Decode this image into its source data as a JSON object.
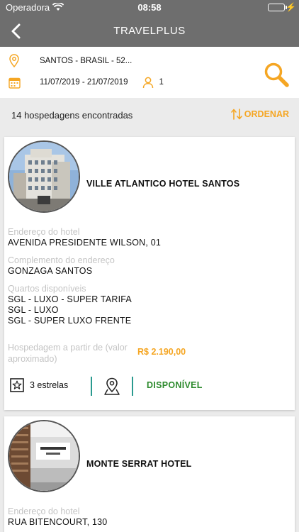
{
  "status_bar": {
    "carrier": "Operadora",
    "time": "08:58"
  },
  "navbar": {
    "title": "TRAVELPLUS"
  },
  "search": {
    "location": "SANTOS - BRASIL - 52...",
    "dates": "11/07/2019 - 21/07/2019",
    "guests": "1"
  },
  "results": {
    "count_text": "14 hospedagens encontradas",
    "order_label": "ORDENAR"
  },
  "labels": {
    "address": "Endereço do hotel",
    "complement": "Complemento do endereço",
    "rooms": "Quartos disponíveis",
    "price_from": "Hospedagem a partir de (valor aproximado)"
  },
  "hotels": [
    {
      "name": "VILLE ATLANTICO HOTEL SANTOS",
      "address": "AVENIDA PRESIDENTE WILSON, 01",
      "complement": "GONZAGA SANTOS",
      "rooms": [
        "SGL - LUXO - SUPER TARIFA",
        "SGL - LUXO",
        "SGL - SUPER LUXO FRENTE"
      ],
      "price": "R$ 2.190,00",
      "stars_text": "3 estrelas",
      "availability": "DISPONÍVEL"
    },
    {
      "name": "MONTE SERRAT HOTEL",
      "address": "RUA BITENCOURT, 130"
    }
  ],
  "colors": {
    "accent": "#f5a623",
    "header": "#6e6e6e",
    "available": "#2e8b2e",
    "divider": "#2a9a8f"
  }
}
